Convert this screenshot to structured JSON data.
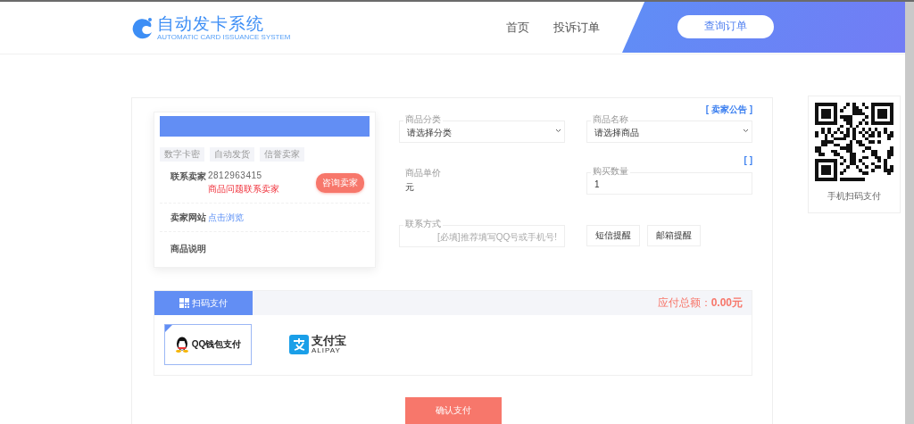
{
  "header": {
    "logo": {
      "title": "自动发卡系统",
      "subtitle": "AUTOMATIC CARD ISSUANCE SYSTEM"
    },
    "nav": [
      {
        "label": "首页"
      },
      {
        "label": "投诉订单"
      }
    ],
    "query_button": "查询订单"
  },
  "seller": {
    "tags": [
      "数字卡密",
      "自动发货",
      "信誉卖家"
    ],
    "contact_label": "联系卖家",
    "contact_value": "2812963415",
    "contact_note": "商品问题联系卖家",
    "consult_button": "咨询卖家",
    "website_label": "卖家网站",
    "website_link": "点击浏览",
    "description_label": "商品说明"
  },
  "form": {
    "notice_link": "[ 卖家公告 ]",
    "bracket_link": "[ ]",
    "category": {
      "label": "商品分类",
      "value": "请选择分类"
    },
    "product": {
      "label": "商品名称",
      "value": "请选择商品"
    },
    "price": {
      "label": "商品单价",
      "value": "元"
    },
    "quantity": {
      "label": "购买数量",
      "value": "1"
    },
    "contact": {
      "label": "联系方式",
      "placeholder": "[必填]推荐填写QQ号或手机号!"
    },
    "buttons": [
      "短信提醒",
      "邮箱提醒"
    ]
  },
  "payment": {
    "tabs": [
      {
        "label": "扫码支付",
        "selected": true
      }
    ],
    "total": "应付总额：**0.00元**",
    "methods": [
      {
        "kind": "qq",
        "label": "QQ钱包支付",
        "selected": true
      },
      {
        "kind": "alipay",
        "label": "支付宝",
        "sublabel": "ALIPAY",
        "selected": false
      }
    ],
    "confirm_button": "确认支付"
  },
  "qr_panel": {
    "caption": "手机扫码支付"
  }
}
